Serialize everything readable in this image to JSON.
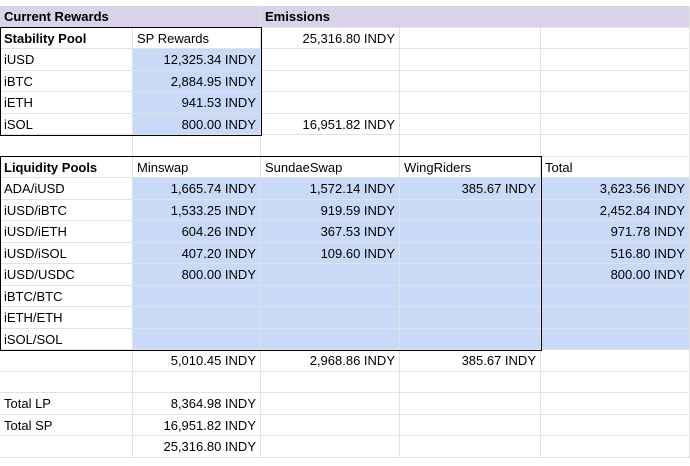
{
  "header": {
    "current_rewards": "Current Rewards",
    "emissions": "Emissions"
  },
  "stability": {
    "title": "Stability Pool",
    "col": "SP Rewards",
    "emission_top": "25,316.80 INDY",
    "emission_bottom": "16,951.82 INDY",
    "rows": [
      {
        "label": "iUSD",
        "value": "12,325.34 INDY"
      },
      {
        "label": "iBTC",
        "value": "2,884.95 INDY"
      },
      {
        "label": "iETH",
        "value": "941.53 INDY"
      },
      {
        "label": "iSOL",
        "value": "800.00 INDY"
      }
    ]
  },
  "liquidity": {
    "title": "Liquidity Pools",
    "columns": [
      "Minswap",
      "SundaeSwap",
      "WingRiders",
      "Total"
    ],
    "rows": [
      {
        "label": "ADA/iUSD",
        "minswap": "1,665.74 INDY",
        "sundae": "1,572.14 INDY",
        "wing": "385.67 INDY",
        "total": "3,623.56 INDY"
      },
      {
        "label": "iUSD/iBTC",
        "minswap": "1,533.25 INDY",
        "sundae": "919.59 INDY",
        "wing": "",
        "total": "2,452.84 INDY"
      },
      {
        "label": "iUSD/iETH",
        "minswap": "604.26 INDY",
        "sundae": "367.53 INDY",
        "wing": "",
        "total": "971.78 INDY"
      },
      {
        "label": "iUSD/iSOL",
        "minswap": "407.20 INDY",
        "sundae": "109.60 INDY",
        "wing": "",
        "total": "516.80 INDY"
      },
      {
        "label": "iUSD/USDC",
        "minswap": "800.00 INDY",
        "sundae": "",
        "wing": "",
        "total": "800.00 INDY"
      },
      {
        "label": "iBTC/BTC",
        "minswap": "",
        "sundae": "",
        "wing": "",
        "total": ""
      },
      {
        "label": "iETH/ETH",
        "minswap": "",
        "sundae": "",
        "wing": "",
        "total": ""
      },
      {
        "label": "iSOL/SOL",
        "minswap": "",
        "sundae": "",
        "wing": "",
        "total": ""
      }
    ],
    "sums": {
      "minswap": "5,010.45 INDY",
      "sundae": "2,968.86 INDY",
      "wing": "385.67 INDY"
    }
  },
  "summary": [
    {
      "label": "Total LP",
      "value": "8,364.98 INDY"
    },
    {
      "label": "Total SP",
      "value": "16,951.82 INDY"
    },
    {
      "label": "",
      "value": "25,316.80 INDY"
    }
  ]
}
